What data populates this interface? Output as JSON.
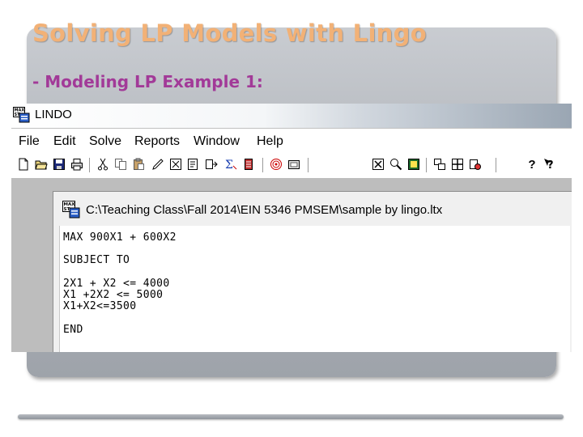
{
  "slide": {
    "title": "Solving LP Models with Lingo",
    "subtitle": "- Modeling LP Example 1:"
  },
  "app": {
    "title": "LINDO",
    "icon": "max-st-app-icon",
    "menu": [
      "File",
      "Edit",
      "Solve",
      "Reports",
      "Window",
      "Help"
    ],
    "toolbar": [
      {
        "name": "new-file-icon"
      },
      {
        "name": "open-folder-icon"
      },
      {
        "name": "save-icon"
      },
      {
        "name": "print-icon"
      },
      {
        "name": "cut-icon"
      },
      {
        "name": "copy-icon"
      },
      {
        "name": "paste-icon"
      },
      {
        "name": "undo-icon"
      },
      {
        "name": "delete-icon"
      },
      {
        "name": "find-icon"
      },
      {
        "name": "go-to-icon"
      },
      {
        "name": "solve-sum-icon"
      },
      {
        "name": "report-icon"
      },
      {
        "name": "target-icon"
      },
      {
        "name": "picture-icon"
      },
      {
        "name": "close-all-icon"
      },
      {
        "name": "zoom-icon"
      },
      {
        "name": "graph-icon"
      },
      {
        "name": "cascade-icon"
      },
      {
        "name": "tile-icon"
      },
      {
        "name": "send-icon"
      },
      {
        "name": "help-icon"
      },
      {
        "name": "context-help-icon"
      }
    ]
  },
  "document": {
    "title": "C:\\Teaching Class\\Fall 2014\\EIN 5346 PMSEM\\sample by lingo.ltx",
    "icon": "max-st-doc-icon",
    "lines": [
      "MAX 900X1 + 600X2",
      "SUBJECT TO",
      "2X1 + X2 <= 4000",
      "X1 +2X2 <= 5000",
      "X1+X2<=3500",
      "END"
    ]
  },
  "colors": {
    "title": "#f2b176",
    "subtitle": "#a23a98",
    "panel": "#b1b5bb"
  }
}
